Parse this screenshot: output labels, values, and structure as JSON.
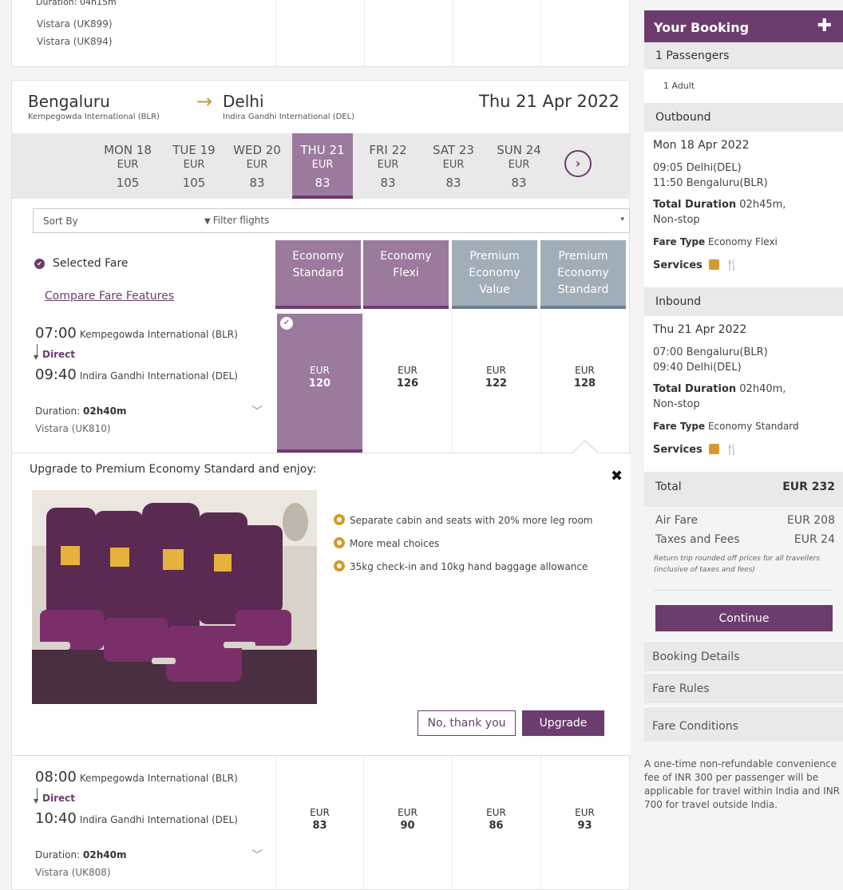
{
  "prev_flight": {
    "duration_cut": "Duration: 04h15m",
    "flight_1": "Vistara (UK899)",
    "flight_2": "Vistara (UK894)"
  },
  "route": {
    "from_city": "Bengaluru",
    "from_airport": "Kempegowda International (BLR)",
    "arrow": "→",
    "to_city": "Delhi",
    "to_airport": "Indira Gandhi International (DEL)",
    "date": "Thu 21 Apr 2022"
  },
  "dates": [
    {
      "day": "MON 18",
      "currency": "EUR",
      "value": "105"
    },
    {
      "day": "TUE 19",
      "currency": "EUR",
      "value": "105"
    },
    {
      "day": "WED 20",
      "currency": "EUR",
      "value": "83"
    },
    {
      "day": "THU 21",
      "currency": "EUR",
      "value": "83"
    },
    {
      "day": "FRI 22",
      "currency": "EUR",
      "value": "83"
    },
    {
      "day": "SAT 23",
      "currency": "EUR",
      "value": "83"
    },
    {
      "day": "SUN 24",
      "currency": "EUR",
      "value": "83"
    }
  ],
  "date_next_glyph": "›",
  "sort": {
    "label": "Sort By",
    "filter_label": "Filter flights",
    "filter_icon": "▼",
    "caret": "▾"
  },
  "fare_header": {
    "selected_fare": "Selected Fare",
    "selected_icon": "✔",
    "compare": "Compare Fare Features",
    "columns": [
      {
        "line1": "Economy",
        "line2": "Standard",
        "line3": ""
      },
      {
        "line1": "Economy",
        "line2": "Flexi",
        "line3": ""
      },
      {
        "line1": "Premium",
        "line2": "Economy",
        "line3": "Value"
      },
      {
        "line1": "Premium",
        "line2": "Economy",
        "line3": "Standard"
      }
    ]
  },
  "flights": [
    {
      "dep_time": "07:00",
      "dep_airport": "Kempegowda International (BLR)",
      "stops": "Direct",
      "arr_time": "09:40",
      "arr_airport": "Indira Gandhi International (DEL)",
      "duration_label": "Duration:",
      "duration": "02h40m",
      "flight_no": "Vistara (UK810)",
      "fares": [
        {
          "currency": "EUR",
          "price": "120"
        },
        {
          "currency": "EUR",
          "price": "126"
        },
        {
          "currency": "EUR",
          "price": "122"
        },
        {
          "currency": "EUR",
          "price": "128"
        }
      ]
    },
    {
      "dep_time": "08:00",
      "dep_airport": "Kempegowda International (BLR)",
      "stops": "Direct",
      "arr_time": "10:40",
      "arr_airport": "Indira Gandhi International (DEL)",
      "duration_label": "Duration:",
      "duration": "02h40m",
      "flight_no": "Vistara (UK808)",
      "fares": [
        {
          "currency": "EUR",
          "price": "83"
        },
        {
          "currency": "EUR",
          "price": "90"
        },
        {
          "currency": "EUR",
          "price": "86"
        },
        {
          "currency": "EUR",
          "price": "93"
        }
      ]
    }
  ],
  "upgrade": {
    "title": "Upgrade to Premium Economy Standard and enjoy:",
    "close": "✖",
    "benefits": [
      "Separate cabin and seats with 20% more leg room",
      "More meal choices",
      "35kg check-in and 10kg hand baggage allowance"
    ],
    "no_thanks": "No, thank you",
    "upgrade_btn": "Upgrade"
  },
  "booking": {
    "title": "Your Booking",
    "plus": "✚",
    "passengers_head": "1 Passengers",
    "passengers": "1 Adult",
    "outbound": {
      "head": "Outbound",
      "date": "Mon 18 Apr 2022",
      "dep": "09:05 Delhi(DEL)",
      "arr": "11:50 Bengaluru(BLR)",
      "duration_label": "Total Duration",
      "duration": "02h45m,",
      "stops": "Non-stop",
      "fare_label": "Fare Type",
      "fare": "Economy Flexi",
      "services": "Services"
    },
    "inbound": {
      "head": "Inbound",
      "date": "Thu 21 Apr 2022",
      "dep": "07:00 Bengaluru(BLR)",
      "arr": "09:40 Delhi(DEL)",
      "duration_label": "Total Duration",
      "duration": "02h40m,",
      "stops": "Non-stop",
      "fare_label": "Fare Type",
      "fare": "Economy Standard",
      "services": "Services"
    },
    "total_label": "Total",
    "total": "EUR 232",
    "air_fare_label": "Air Fare",
    "air_fare": "EUR 208",
    "taxes_label": "Taxes and Fees",
    "taxes": "EUR 24",
    "note_1": "Return trip rounded off prices for all travellers",
    "note_2": "(inclusive of taxes and fees)",
    "continue": "Continue",
    "links": [
      "Booking Details",
      "Fare Rules",
      "Fare Conditions"
    ],
    "fee_note": "A one-time non-refundable convenience fee of INR 300 per passenger will be applicable for travel within India and INR 700 for travel outside India.",
    "cutlery_glyph": "🍴"
  }
}
